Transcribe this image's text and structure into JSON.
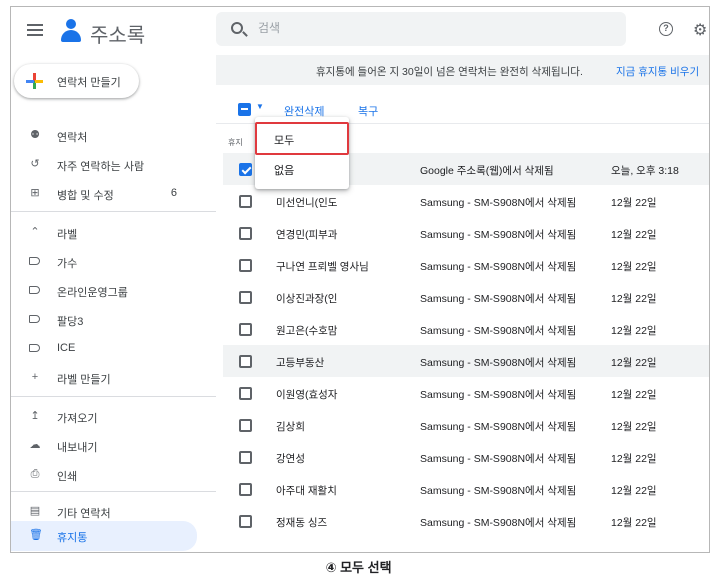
{
  "app": {
    "title": "주소록"
  },
  "sidebar": {
    "create_label": "연락처 만들기",
    "items": [
      {
        "label": "연락처",
        "icon": "person-icon"
      },
      {
        "label": "자주 연락하는 사람",
        "icon": "history-icon"
      },
      {
        "label": "병합 및 수정",
        "icon": "merge-icon",
        "count": "6"
      }
    ],
    "labels_header": "라벨",
    "labels": [
      {
        "label": "가수"
      },
      {
        "label": "온라인운영그룹"
      },
      {
        "label": "팔당3"
      },
      {
        "label": "ICE"
      }
    ],
    "create_label_item": "라벨 만들기",
    "tools": [
      {
        "label": "가져오기",
        "icon": "upload-icon"
      },
      {
        "label": "내보내기",
        "icon": "cloud-download-icon"
      },
      {
        "label": "인쇄",
        "icon": "print-icon"
      }
    ],
    "other_contacts": "기타 연락처",
    "trash": "휴지통"
  },
  "search": {
    "placeholder": "검색"
  },
  "banner": {
    "text": "휴지통에 들어온 지 30일이 넘은 연락처는 완전히 삭제됩니다.",
    "link": "지금 휴지통 비우기"
  },
  "toolbar": {
    "delete_forever": "완전삭제",
    "restore": "복구"
  },
  "section_label": "휴지",
  "dropdown": {
    "all": "모두",
    "none": "없음"
  },
  "rows": [
    {
      "name": "",
      "source": "Google 주소록(웹)에서 삭제됨",
      "date": "오늘, 오후 3:18",
      "checked": true
    },
    {
      "name": "미선언니(인도",
      "source": "Samsung - SM-S908N에서 삭제됨",
      "date": "12월 22일"
    },
    {
      "name": "연경민(피부과",
      "source": "Samsung - SM-S908N에서 삭제됨",
      "date": "12월 22일"
    },
    {
      "name": "구나연 프뢰벨 영사님",
      "source": "Samsung - SM-S908N에서 삭제됨",
      "date": "12월 22일"
    },
    {
      "name": "이상진과장(인",
      "source": "Samsung - SM-S908N에서 삭제됨",
      "date": "12월 22일"
    },
    {
      "name": "원고은(수호맘",
      "source": "Samsung - SM-S908N에서 삭제됨",
      "date": "12월 22일"
    },
    {
      "name": "고등부동산",
      "source": "Samsung - SM-S908N에서 삭제됨",
      "date": "12월 22일"
    },
    {
      "name": "이원영(효성자",
      "source": "Samsung - SM-S908N에서 삭제됨",
      "date": "12월 22일"
    },
    {
      "name": "김상희",
      "source": "Samsung - SM-S908N에서 삭제됨",
      "date": "12월 22일"
    },
    {
      "name": "강연성",
      "source": "Samsung - SM-S908N에서 삭제됨",
      "date": "12월 22일"
    },
    {
      "name": "아주대 재활치",
      "source": "Samsung - SM-S908N에서 삭제됨",
      "date": "12월 22일"
    },
    {
      "name": "정재동 싱즈",
      "source": "Samsung - SM-S908N에서 삭제됨",
      "date": "12월 22일"
    }
  ],
  "caption": "④ 모두 선택",
  "colors": {
    "accent": "#1a73e8",
    "highlight_box": "#e0393e",
    "active_bg": "#e8f0fe"
  }
}
